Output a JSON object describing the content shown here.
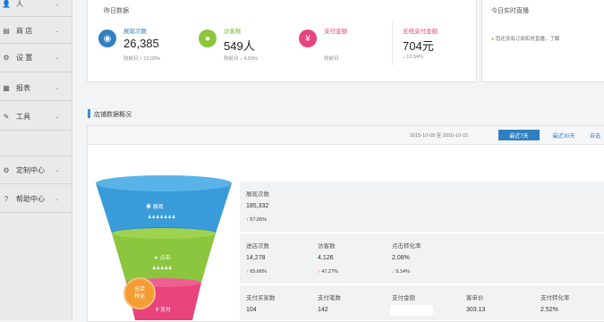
{
  "sidebar": {
    "items": [
      {
        "icon": "user-icon",
        "label": "人"
      },
      {
        "icon": "store-icon",
        "label": "商 店"
      },
      {
        "icon": "gear-icon",
        "label": "设 置"
      },
      {
        "icon": "report-icon",
        "label": "报表"
      },
      {
        "icon": "tools-icon",
        "label": "工具"
      },
      {
        "icon": "settings-icon",
        "label": "定制中心"
      },
      {
        "icon": "help-icon",
        "label": "帮助中心"
      }
    ]
  },
  "yesterday": {
    "title": "昨日数据",
    "stats": [
      {
        "icon": "eye-icon",
        "color": "#2f7fc1",
        "label": "展现次数",
        "label_color": "#2f7fc1",
        "value": "26,385",
        "sub": "较前日",
        "trend": "↑",
        "change": "12.03%"
      },
      {
        "icon": "person-icon",
        "color": "#8cc63f",
        "label": "访客数",
        "label_color": "#7ab833",
        "value": "549人",
        "sub": "较前日",
        "trend": "↓",
        "change": "4.55%"
      },
      {
        "icon": "yen-icon",
        "color": "#e8437c",
        "label": "支付金额",
        "label_color": "#e8437c",
        "value": "",
        "sub": "较前日",
        "trend": "",
        "change": ""
      },
      {
        "icon": "",
        "color": "",
        "label": "无线支付金额",
        "label_color": "#e8437c",
        "value": "704元",
        "sub": "",
        "trend": "↓",
        "change": "12.54%"
      }
    ]
  },
  "realtime": {
    "title": "今日实时直播",
    "notice": "您还没有订阅实时直播，了解"
  },
  "overview": {
    "title": "店铺数据概况",
    "date_start": "2015-10-09",
    "date_sep": "至",
    "date_end": "2015-10-15",
    "buttons": [
      {
        "label": "最近7天",
        "active": true
      },
      {
        "label": "最近30天",
        "active": false
      },
      {
        "label": "自选",
        "active": false
      }
    ]
  },
  "funnel": {
    "stages": [
      {
        "icon": "eye-icon",
        "label": "展现",
        "color": "#3a9bd9"
      },
      {
        "icon": "cursor-icon",
        "label": "点击",
        "color": "#8cc63f"
      },
      {
        "icon": "yen-icon",
        "label": "支付",
        "color": "#e8437c"
      }
    ],
    "badge": {
      "line1": "全店",
      "line2": "转化"
    },
    "rows": [
      [
        {
          "label": "展现次数",
          "value": "185,332",
          "trend": "↑",
          "change": "57.05%"
        }
      ],
      [
        {
          "label": "进店次数",
          "value": "14,278",
          "trend": "↑",
          "change": "65.66%"
        },
        {
          "label": "访客数",
          "value": "4,126",
          "trend": "↑",
          "change": "47.27%"
        },
        {
          "label": "点击转化率",
          "value": "2.08%",
          "trend": "↓",
          "change": "9.14%"
        }
      ],
      [
        {
          "label": "支付买家数",
          "value": "104",
          "trend": "",
          "change": ""
        },
        {
          "label": "支付笔数",
          "value": "142",
          "trend": "",
          "change": ""
        },
        {
          "label": "支付金额",
          "value": "",
          "trend": "",
          "change": ""
        },
        {
          "label": "客单价",
          "value": "303.13",
          "trend": "",
          "change": ""
        },
        {
          "label": "支付转化率",
          "value": "2.52%",
          "trend": "",
          "change": ""
        }
      ]
    ]
  }
}
